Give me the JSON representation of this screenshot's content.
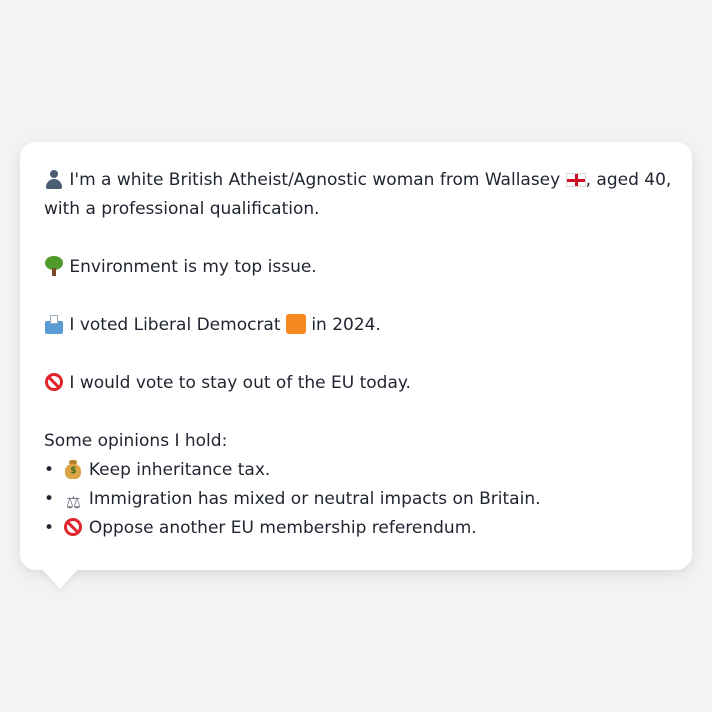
{
  "profile": {
    "intro_line1_a": "I'm a white British Atheist/Agnostic woman from Wallasey",
    "intro_line1_b": ", aged 40,",
    "intro_line2": "with a professional qualification.",
    "top_issue": "Environment is my top issue.",
    "vote_a": "I voted Liberal Democrat",
    "vote_b": "in 2024.",
    "eu_stance": "I would vote to stay out of the EU today.",
    "opinions_header": "Some opinions I hold:",
    "opinions": [
      {
        "text": "Keep inheritance tax.",
        "icon": "money-bag-icon"
      },
      {
        "text": "Immigration has mixed or neutral impacts on Britain.",
        "icon": "scales-icon"
      },
      {
        "text": "Oppose another EU membership referendum.",
        "icon": "no-entry-icon"
      }
    ],
    "bullet": "•",
    "money_sign": "$",
    "scales_glyph": "⚖"
  },
  "colors": {
    "background": "#f2f3f5",
    "card": "#ffffff",
    "text": "#1f2430",
    "england_red": "#ce1124",
    "lib_dem_orange": "#f5891f",
    "no_entry_red": "#e0242b"
  }
}
